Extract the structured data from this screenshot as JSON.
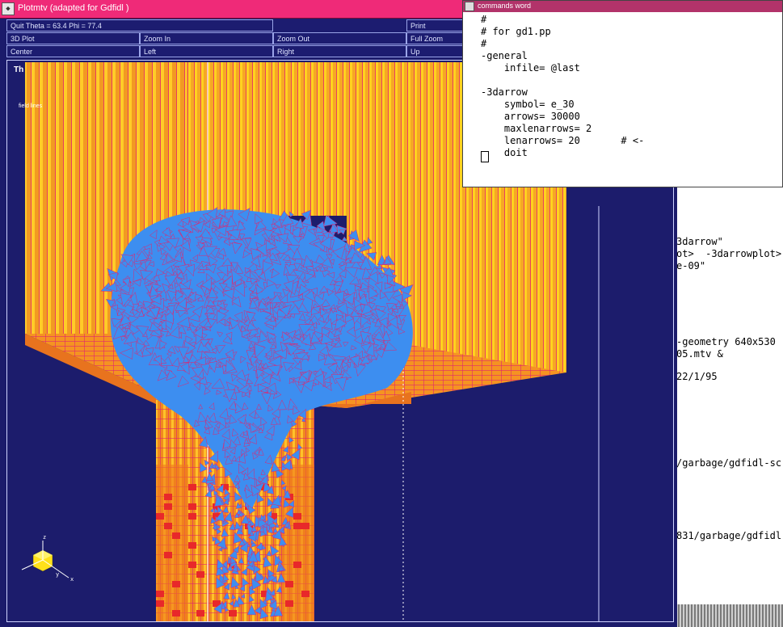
{
  "plot_window": {
    "title": "Plotmtv (adapted for Gdfidl )",
    "menu": [
      [
        "Quit   Theta = 63.4   Phi = 77.4",
        "",
        "",
        "Print"
      ],
      [
        "3D Plot",
        "Zoom In",
        "Zoom Out",
        "Full Zoom"
      ],
      [
        "Center",
        "Left",
        "Right",
        "Up"
      ]
    ],
    "plot_title": "Th",
    "plot_subtitle": "field   lines",
    "axes": {
      "z": "z",
      "x": "x",
      "y": "y"
    },
    "colors": {
      "walls": "#f5a623",
      "arrows": "#3d8ef0",
      "edges": "#e2246e",
      "background": "#1c1c6c"
    }
  },
  "commands_window": {
    "title": "commands word",
    "lines": [
      "#",
      "# for gd1.pp",
      "#",
      "-general",
      "    infile= @last",
      "",
      "-3darrow",
      "    symbol= e_30",
      "    arrows= 30000",
      "    maxlenarrows= 2",
      "    lenarrows= 20       # <-",
      "    doit"
    ]
  },
  "terminal": {
    "lines": [
      "3darrow\"",
      "ot>  -3darrowplot>",
      "e-09\"",
      "-geometry 640x530",
      "05.mtv &",
      "22/1/95",
      "/garbage/gdfidl-sc",
      "831/garbage/gdfidl"
    ]
  }
}
